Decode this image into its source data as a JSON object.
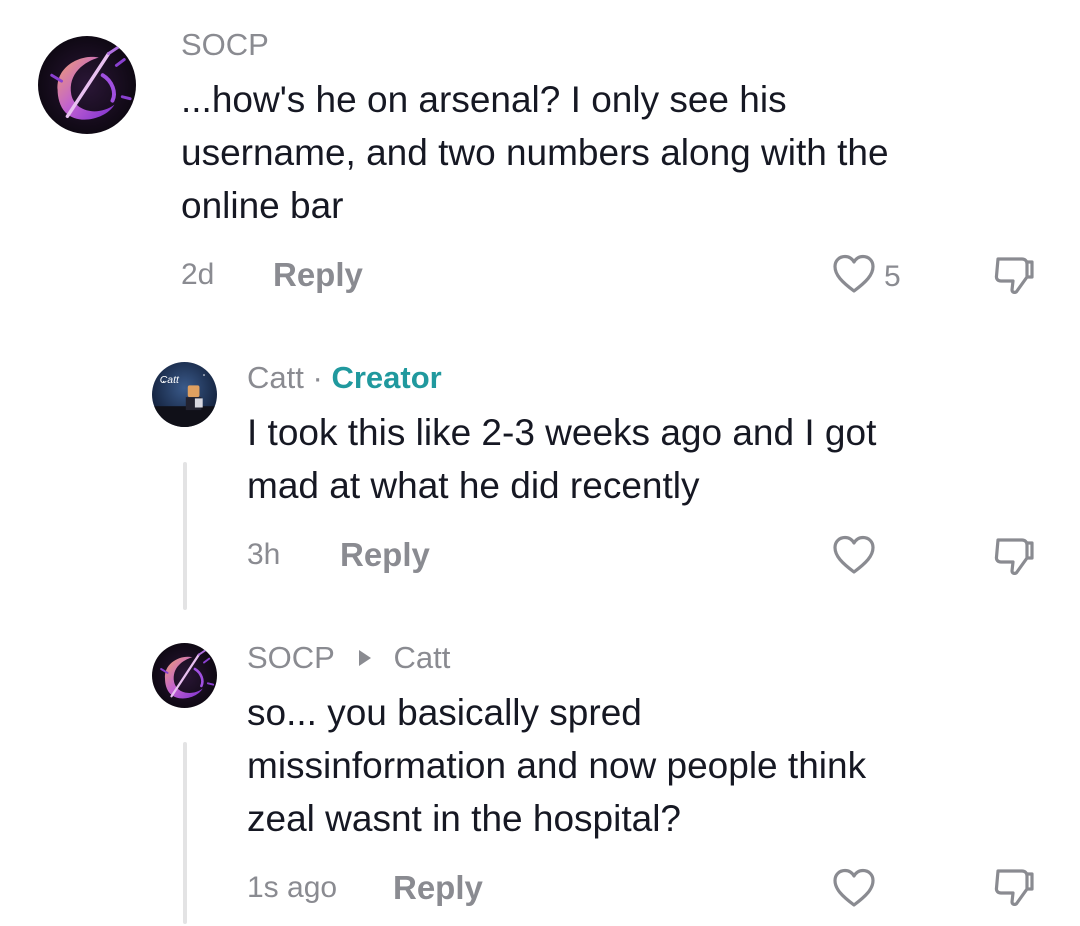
{
  "comments": [
    {
      "username": "SOCP",
      "text": "...how's he on arsenal? I only see his\nusername, and two numbers along with the\nonline bar",
      "time": "2d",
      "reply_label": "Reply",
      "like_count": "5"
    },
    {
      "username": "Catt",
      "separator": "·",
      "badge": "Creator",
      "avatar_label": "Catt",
      "text": "I took this like 2-3 weeks ago and I got\nmad at what he did recently",
      "time": "3h",
      "reply_label": "Reply"
    },
    {
      "username": "SOCP",
      "reply_to": "Catt",
      "text": "so... you basically spred\nmissinformation and now people think\nzeal wasnt in the hospital?",
      "time": "1s ago",
      "reply_label": "Reply"
    }
  ],
  "icons": {
    "like": "heart-outline-icon",
    "dislike": "thumbs-down-outline-icon"
  },
  "colors": {
    "text_primary": "#161823",
    "text_secondary": "#8a8b91",
    "creator_badge": "#20999e",
    "thread_line": "#e3e3e4"
  }
}
